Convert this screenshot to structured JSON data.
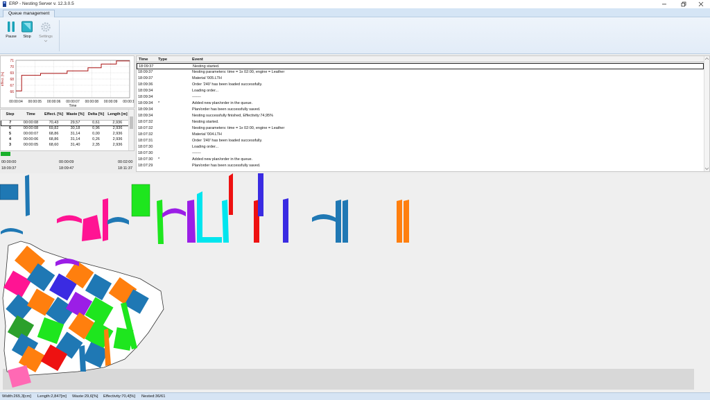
{
  "window": {
    "title": "ERP - Nesting Server v. 12.3.0.5",
    "icon": "app-icon"
  },
  "tabs": [
    {
      "label": "Queue management",
      "active": true
    }
  ],
  "toolbar": {
    "pause_label": "Pause",
    "stop_label": "Stop",
    "settings_label": "Settings"
  },
  "chart_data": {
    "type": "line",
    "x": [
      "00:00:04",
      "00:00:05",
      "00:00:06",
      "00:00:07",
      "00:00:08",
      "00:00:09",
      "00:00:10"
    ],
    "xlabel": "Time",
    "ylabel": "Effect. [%]",
    "ylim": [
      65,
      71
    ],
    "yticks": [
      66,
      67,
      68,
      69,
      70,
      71
    ],
    "grid": true,
    "color": "#aa1111",
    "points": [
      [
        4.0,
        66.1
      ],
      [
        4.3,
        66.1
      ],
      [
        4.3,
        68.6
      ],
      [
        5.3,
        68.6
      ],
      [
        5.3,
        68.9
      ],
      [
        6.7,
        68.9
      ],
      [
        6.7,
        69.3
      ],
      [
        7.8,
        69.3
      ],
      [
        7.8,
        69.8
      ],
      [
        8.5,
        69.8
      ],
      [
        8.5,
        70.4
      ],
      [
        9.3,
        70.4
      ],
      [
        9.3,
        70.9
      ],
      [
        10.0,
        70.9
      ]
    ]
  },
  "steps": {
    "columns": [
      "Step",
      "Time",
      "Effect. [%]",
      "Waste [%]",
      "Delta [%]",
      "Length [m]"
    ],
    "rows": [
      {
        "step": "7",
        "time": "00:00:08",
        "effect": "70,43",
        "waste": "29,57",
        "delta": "0,61",
        "length": "2,936",
        "selected": true
      },
      {
        "step": "6",
        "time": "00:00:08",
        "effect": "69,82",
        "waste": "30,18",
        "delta": "0,96",
        "length": "2,936"
      },
      {
        "step": "5",
        "time": "00:00:07",
        "effect": "68,86",
        "waste": "31,14",
        "delta": "0,00",
        "length": "2,936"
      },
      {
        "step": "4",
        "time": "00:00:06",
        "effect": "68,86",
        "waste": "31,14",
        "delta": "0,26",
        "length": "2,936"
      },
      {
        "step": "3",
        "time": "00:00:05",
        "effect": "68,60",
        "waste": "31,40",
        "delta": "2,35",
        "length": "2,936"
      }
    ]
  },
  "progress": {
    "fraction": 0.07,
    "color": "#19b02b",
    "elapsed_start": "00:00:00",
    "elapsed_mid": "00:00:09",
    "elapsed_end": "00:02:00",
    "clock_start": "18:09:37",
    "clock_mid": "18:09:47",
    "clock_end": "18:11:37"
  },
  "log": {
    "columns": [
      "Time",
      "Type",
      "Event"
    ],
    "rows": [
      {
        "time": "18:09:37",
        "type": "",
        "event": "Nesting started.",
        "selected": true
      },
      {
        "time": "18:09:37",
        "type": "",
        "event": "Nesting parameters: time = 1x 02:00, engine = Leather"
      },
      {
        "time": "18:09:37",
        "type": "",
        "event": "Material '005.LTH"
      },
      {
        "time": "18:09:36",
        "type": "",
        "event": "Order '240' has been loaded successfully."
      },
      {
        "time": "18:09:34",
        "type": "",
        "event": "Loading order..."
      },
      {
        "time": "18:09:34",
        "type": "",
        "event": "-------"
      },
      {
        "time": "18:09:34",
        "type": "*",
        "event": "Added new plan/order in the queue."
      },
      {
        "time": "18:09:34",
        "type": "",
        "event": "Plan/order has been successfully saved."
      },
      {
        "time": "18:09:34",
        "type": "",
        "event": "Nesting successfully finished, Effectivity:74,95%"
      },
      {
        "time": "18:07:32",
        "type": "",
        "event": "Nesting started."
      },
      {
        "time": "18:07:32",
        "type": "",
        "event": "Nesting parameters: time = 1x 02:00, engine = Leather"
      },
      {
        "time": "18:07:32",
        "type": "",
        "event": "Material '004.LTH"
      },
      {
        "time": "18:07:31",
        "type": "",
        "event": "Order '240' has been loaded successfully."
      },
      {
        "time": "18:07:30",
        "type": "",
        "event": "Loading order..."
      },
      {
        "time": "18:07:30",
        "type": "",
        "event": "-------"
      },
      {
        "time": "18:07:30",
        "type": "*",
        "event": "Added new plan/order in the queue."
      },
      {
        "time": "18:07:29",
        "type": "",
        "event": "Plan/order has been successfully saved."
      }
    ]
  },
  "nesting": {
    "piece_colors": [
      "#1f78b4",
      "#ff7f0e",
      "#ff1493",
      "#2ca02c",
      "#1ee61e",
      "#3a2be2",
      "#9b1ee6",
      "#00e5ee",
      "#ee1111",
      "#1e90ff",
      "#ff69b4"
    ]
  },
  "status": {
    "width": "Width:265,3[cm]",
    "length": "Length:2,847[m]",
    "waste": "Waste:29,6[%]",
    "effectivity": "Effectivity:70,4[%]",
    "nested": "Nested:36/61"
  }
}
